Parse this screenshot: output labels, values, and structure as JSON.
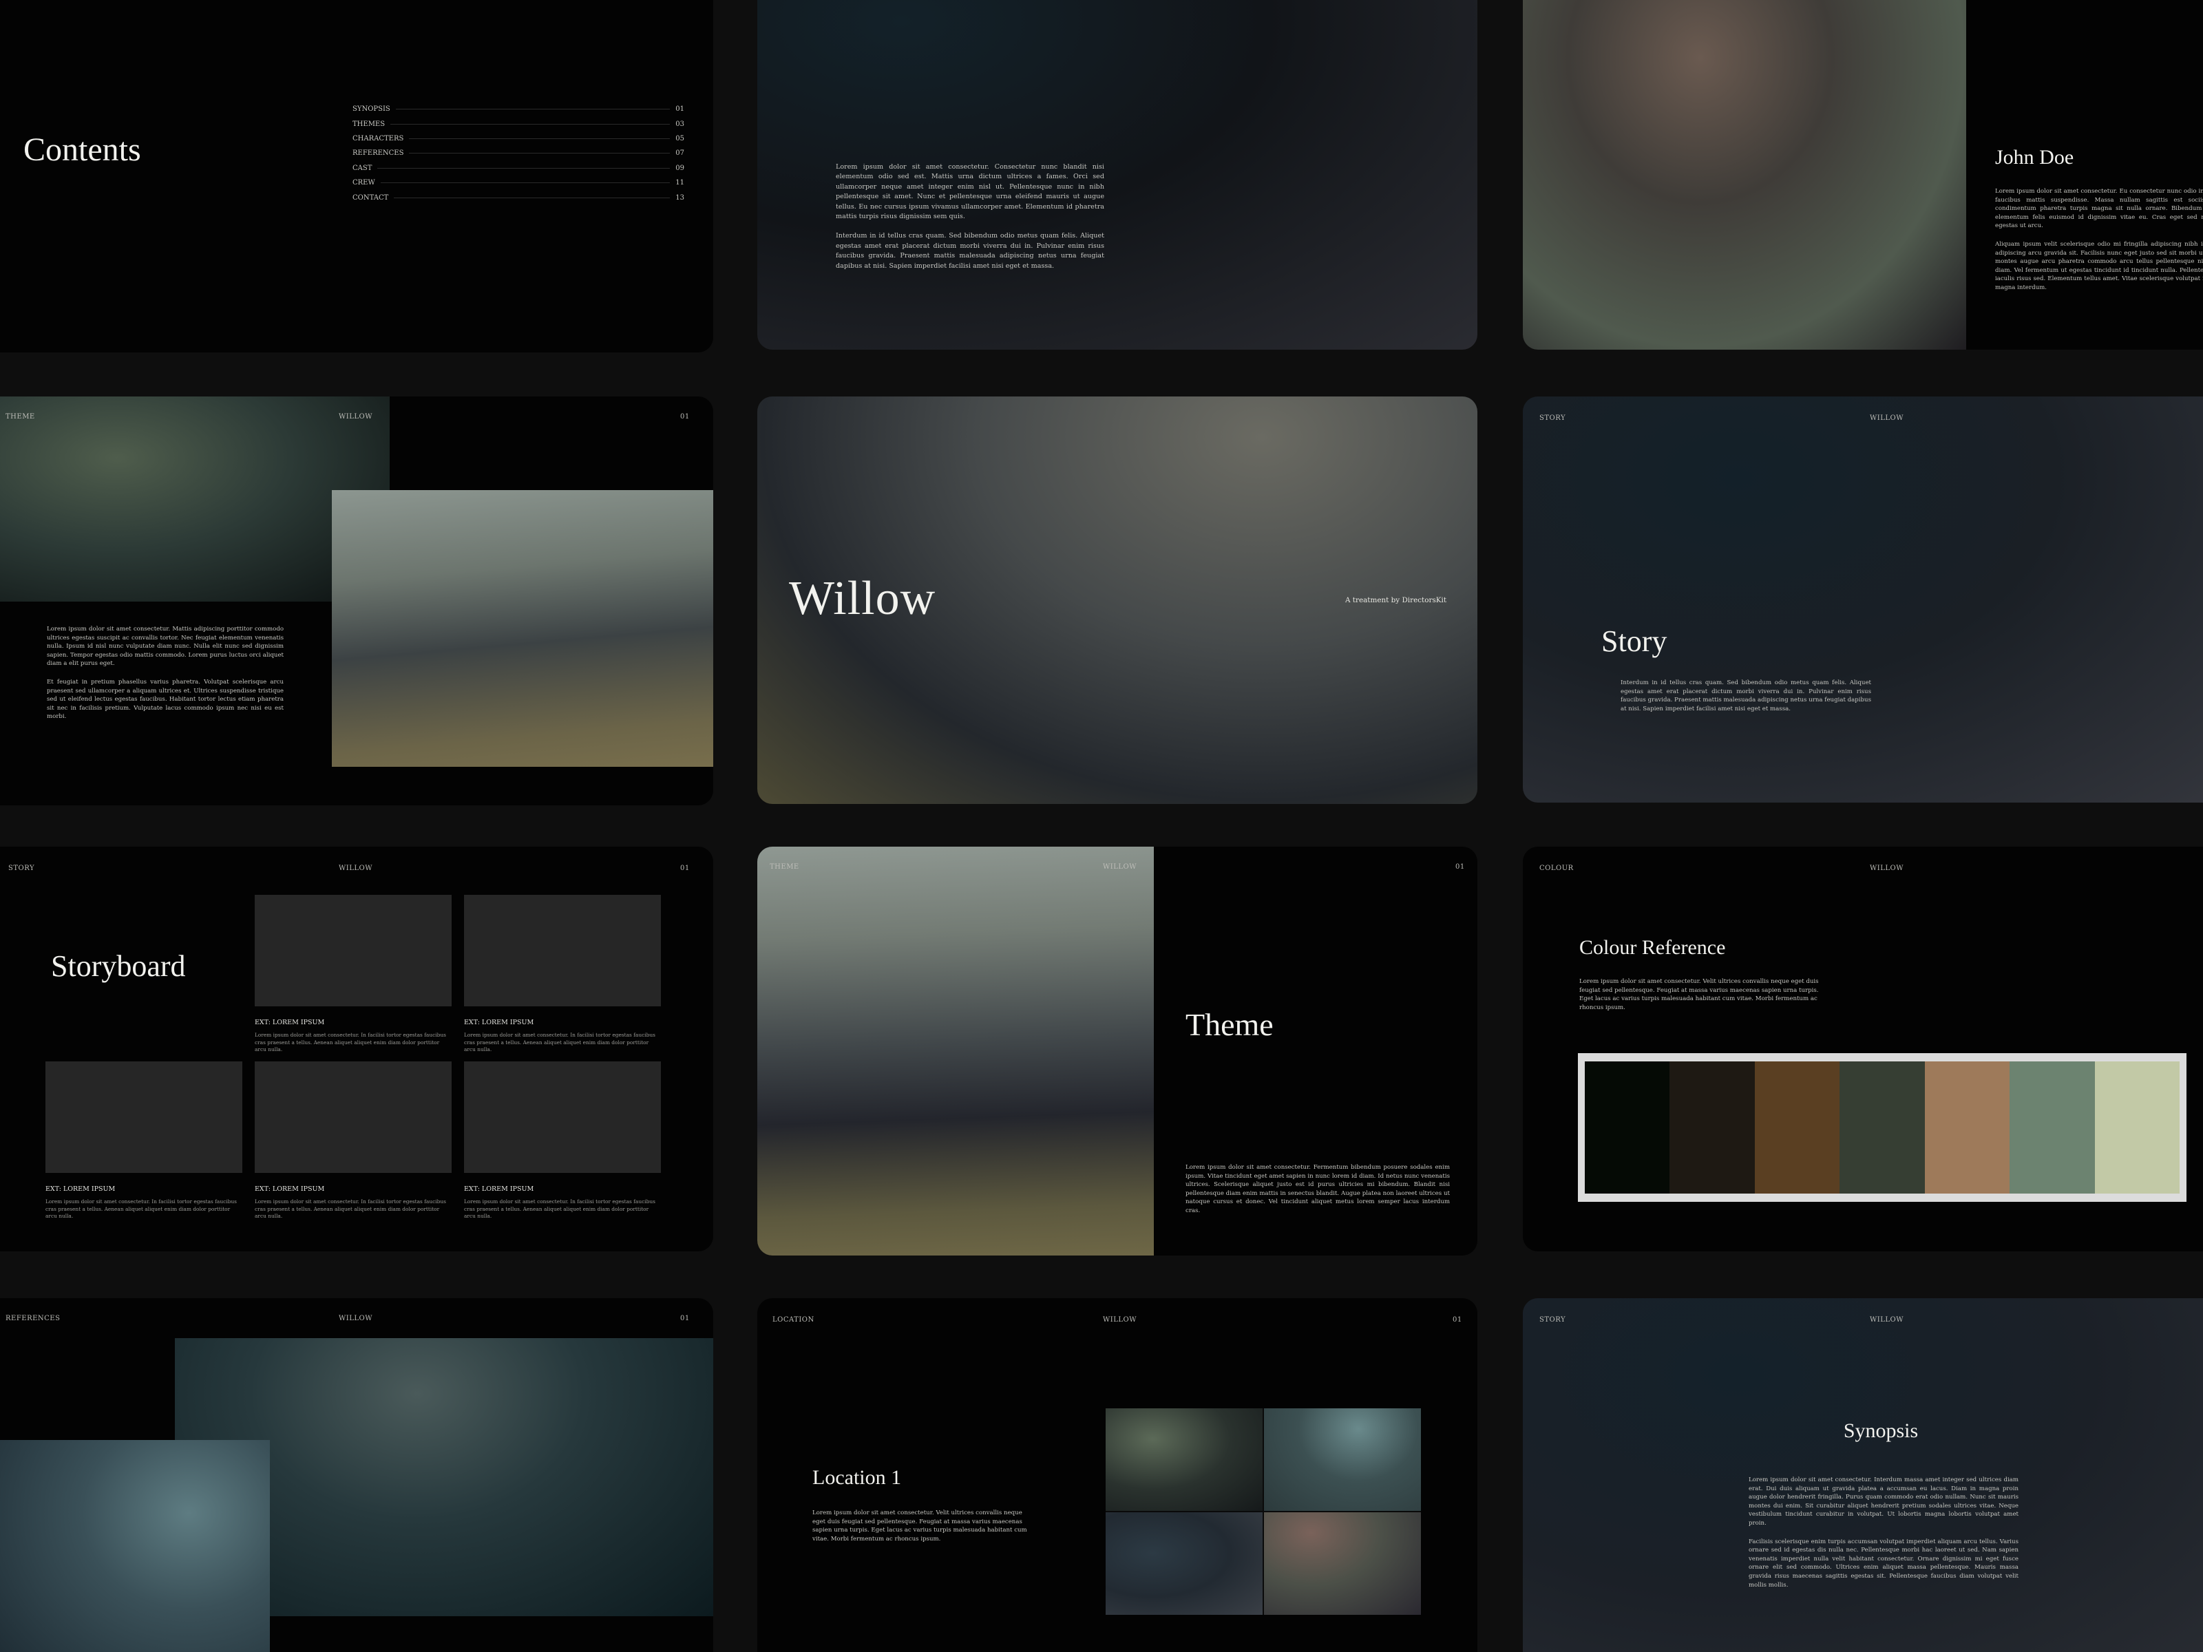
{
  "brand": "WILLOW",
  "page_num": "01",
  "contents": {
    "title": "Contents",
    "items": [
      {
        "label": "SYNOPSIS",
        "page": "01"
      },
      {
        "label": "THEMES",
        "page": "03"
      },
      {
        "label": "CHARACTERS",
        "page": "05"
      },
      {
        "label": "REFERENCES",
        "page": "07"
      },
      {
        "label": "CAST",
        "page": "09"
      },
      {
        "label": "CREW",
        "page": "11"
      },
      {
        "label": "CONTACT",
        "page": "13"
      }
    ]
  },
  "lorem_slide": {
    "p1": "Lorem ipsum dolor sit amet consectetur. Consectetur nunc blandit nisi elementum odio sed est. Mattis urna dictum ultrices a fames. Orci sed ullamcorper neque amet integer enim nisl ut. Pellentesque nunc in nibh pellentesque sit amet. Nunc et pellentesque urna eleifend mauris ut augue tellus. Eu nec cursus ipsum vivamus ullamcorper amet. Elementum id pharetra mattis turpis risus dignissim sem quis.",
    "p2": "Interdum in id tellus cras quam. Sed bibendum odio metus quam felis. Aliquet egestas amet erat placerat dictum morbi viverra dui in. Pulvinar enim risus faucibus gravida. Praesent mattis malesuada adipiscing netus urna feugiat dapibus at nisi. Sapien imperdiet facilisi amet nisi eget et massa."
  },
  "john": {
    "name": "John Doe",
    "p1": "Lorem ipsum dolor sit amet consectetur. Eu consectetur nunc odio in et venenatis faucibus mattis suspendisse. Massa nullam sagittis est sociis. Commodo condimentum pharetra turpis magna sit nulla ornare. Bibendum volutpat vel elementum felis euismod id dignissim vitae eu. Cras eget sed molestie duis egestas ut arcu.",
    "p2": "Aliquam ipsum velit scelerisque odio mi fringilla adipiscing nibh ipsum dictum adipiscing arcu gravida sit. Facilisis nunc eget justo sed sit morbi ut turpis. Quis montes augue arcu pharetra commodo arcu tellus pellentesque nisl fusce cum diam. Vel fermentum ut egestas tincidunt id tincidunt nulla. Pellentesque nunc et iaculis risus sed. Elementum tellus amet. Vitae scelerisque volutpat facilisi massa magna interdum."
  },
  "theme1": {
    "label": "THEME",
    "p1": "Lorem ipsum dolor sit amet consectetur. Mattis adipiscing porttitor commodo ultrices egestas suscipit ac convallis tortor. Nec feugiat elementum venenatis nulla. Ipsum id nisl nunc vulputate diam nunc. Nulla elit nunc sed dignissim sapien. Tempor egestas odio mattis commodo. Lorem purus luctus orci aliquet diam a elit purus eget.",
    "p2": "Et feugiat in pretium phasellus varius pharetra. Volutpat scelerisque arcu praesent sed ullamcorper a aliquam ultrices et. Ultrices suspendisse tristique sed ut eleifend lectus egestas faucibus. Habitant tortor lectus etiam pharetra sit nec in facilisis pretium. Vulputate lacus commodo ipsum nec nisi eu est morbi."
  },
  "willow": {
    "title": "Willow",
    "tagline": "A treatment by DirectorsKit"
  },
  "story": {
    "label": "STORY",
    "title": "Story",
    "p1": "Interdum in id tellus cras quam. Sed bibendum odio metus quam felis. Aliquet egestas amet erat placerat dictum morbi viverra dui in. Pulvinar enim risus faucibus gravida. Praesent mattis malesuada adipiscing netus urna feugiat dapibus at nisi. Sapien imperdiet facilisi amet nisi eget et massa."
  },
  "storyboard": {
    "label": "STORY",
    "title": "Storyboard",
    "frames": [
      {
        "title": "EXT: LOREM IPSUM",
        "desc": "Lorem ipsum dolor sit amet consectetur. In facilisi tortor egestas faucibus cras praesent a tellus. Aenean aliquet aliquet enim diam dolor porttitor arcu nulla."
      },
      {
        "title": "EXT: LOREM IPSUM",
        "desc": "Lorem ipsum dolor sit amet consectetur. In facilisi tortor egestas faucibus cras praesent a tellus. Aenean aliquet aliquet enim diam dolor porttitor arcu nulla."
      },
      {
        "title": "EXT: LOREM IPSUM",
        "desc": "Lorem ipsum dolor sit amet consectetur. In facilisi tortor egestas faucibus cras praesent a tellus. Aenean aliquet aliquet enim diam dolor porttitor arcu nulla."
      },
      {
        "title": "EXT: LOREM IPSUM",
        "desc": "Lorem ipsum dolor sit amet consectetur. In facilisi tortor egestas faucibus cras praesent a tellus. Aenean aliquet aliquet enim diam dolor porttitor arcu nulla."
      },
      {
        "title": "EXT: LOREM IPSUM",
        "desc": "Lorem ipsum dolor sit amet consectetur. In facilisi tortor egestas faucibus cras praesent a tellus. Aenean aliquet aliquet enim diam dolor porttitor arcu nulla."
      }
    ]
  },
  "theme2": {
    "label": "THEME",
    "title": "Theme",
    "p1": "Lorem ipsum dolor sit amet consectetur. Fermentum bibendum posuere sodales enim ipsum. Vitae tincidunt eget amet sapien in nunc lorem id diam. Id netus nunc venenatis ultrices. Scelerisque aliquet justo est id purus ultricies mi bibendum. Blandit nisi pellentesque diam enim mattis in senectus blandit. Augue platea non laoreet ultrices ut natoque cursus et donec. Vel tincidunt aliquet metus lorem semper lacus interdum cras."
  },
  "colour": {
    "label": "COLOUR",
    "title": "Colour Reference",
    "p1": "Lorem ipsum dolor sit amet consectetur. Velit ultrices convallis neque eget duis feugiat sed pellentesque. Feugiat at massa varius maecenas sapien urna turpis. Eget lacus ac varius turpis malesuada habitant cum vitae. Morbi fermentum ac rhoncus ipsum.",
    "swatches": [
      "#050a05",
      "#1e1913",
      "#5a3f22",
      "#363e33",
      "#9e7a5a",
      "#6c8370",
      "#c2c9a6"
    ]
  },
  "refs": {
    "label": "REFERENCES"
  },
  "location": {
    "label": "LOCATION",
    "title": "Location 1",
    "p1": "Lorem ipsum dolor sit amet consectetur. Velit ultrices convallis neque eget duis feugiat sed pellentesque. Feugiat at massa varius maecenas sapien urna turpis. Eget lacus ac varius turpis malesuada habitant cum vitae. Morbi fermentum ac rhoncus ipsum."
  },
  "synopsis": {
    "label": "STORY",
    "title": "Synopsis",
    "p1": "Lorem ipsum dolor sit amet consectetur. Interdum massa amet integer sed ultrices diam erat. Dui duis aliquam ut gravida platea a accumsan eu lacus. Diam in magna proin augue dolor hendrerit fringilla. Purus quam commodo erat odio nullam. Nunc sit mauris montes dui enim. Sit curabitur aliquet hendrerit pretium sodales ultrices vitae. Neque vestibulum tincidunt curabitur in volutpat. Ut lobortis magna lobortis volutpat amet proin.",
    "p2": "Facilisis scelerisque enim turpis accumsan volutpat imperdiet aliquam arcu tellus. Varius ornare sed id egestas dis nulla nec. Pellentesque morbi hac laoreet ut sed. Nam sapien venenatis imperdiet nulla velit habitant consectetur. Ornare dignissim mi eget fusce ornare elit sed commodo. Ultrices enim aliquet massa pellentesque. Mauris massa gravida risus maecenas sagittis egestas sit. Pellentesque faucibus diam volutpat velit mollis mollis."
  }
}
